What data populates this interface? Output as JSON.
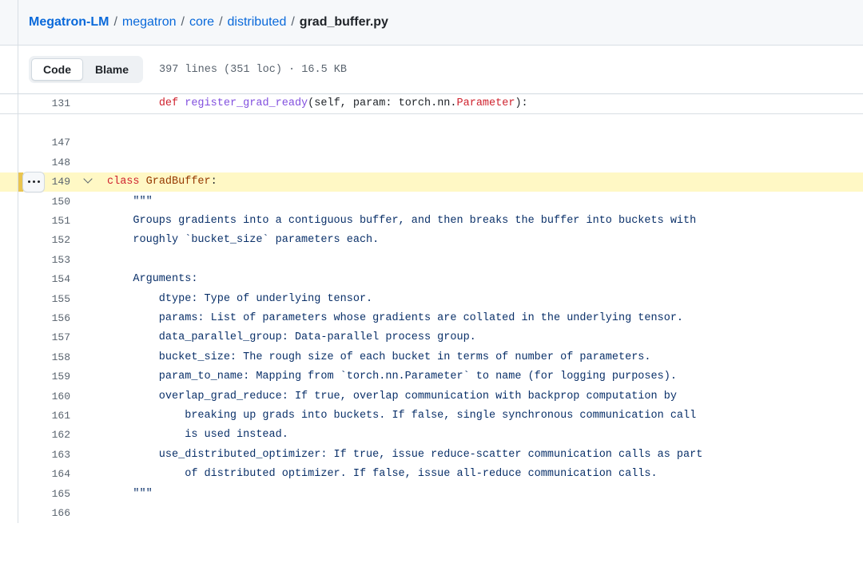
{
  "breadcrumb": {
    "repo": "Megatron-LM",
    "separator": "/",
    "path_parts": [
      "megatron",
      "core",
      "distributed"
    ],
    "filename": "grad_buffer.py"
  },
  "toolbar": {
    "code_tab": "Code",
    "blame_tab": "Blame",
    "file_meta": "397 lines (351 loc) · 16.5 KB",
    "kebab_label": "···"
  },
  "colors": {
    "highlight_bg": "#fff8c5",
    "highlight_marker": "#eac54f",
    "link": "#0969da",
    "keyword": "#cf222e",
    "function": "#8250df",
    "class_name": "#953800",
    "string": "#0a3069",
    "text": "#1f2328",
    "line_number": "#59636e",
    "header_bg": "#f6f8fa",
    "border": "#d8dee4"
  },
  "code": {
    "lines": [
      {
        "num": "131",
        "highlighted": false,
        "fold": "",
        "kebab": false,
        "tokens": [
          {
            "t": "        ",
            "c": "tok-pln"
          },
          {
            "t": "def",
            "c": "tok-kw"
          },
          {
            "t": " ",
            "c": "tok-pln"
          },
          {
            "t": "register_grad_ready",
            "c": "tok-fn"
          },
          {
            "t": "(self, param: torch.nn.",
            "c": "tok-pln"
          },
          {
            "t": "Parameter",
            "c": "tok-type"
          },
          {
            "t": "):",
            "c": "tok-pln"
          }
        ]
      },
      {
        "num": "147",
        "highlighted": false,
        "fold": "",
        "kebab": false,
        "gap_before": true,
        "tokens": []
      },
      {
        "num": "148",
        "highlighted": false,
        "fold": "",
        "kebab": false,
        "tokens": []
      },
      {
        "num": "149",
        "highlighted": true,
        "fold": "chevron-down",
        "kebab": true,
        "tokens": [
          {
            "t": "class",
            "c": "tok-kw"
          },
          {
            "t": " ",
            "c": "tok-pln"
          },
          {
            "t": "GradBuffer",
            "c": "tok-cls"
          },
          {
            "t": ":",
            "c": "tok-pln"
          }
        ]
      },
      {
        "num": "150",
        "highlighted": false,
        "fold": "",
        "kebab": false,
        "tokens": [
          {
            "t": "    \"\"\"",
            "c": "tok-str"
          }
        ]
      },
      {
        "num": "151",
        "highlighted": false,
        "fold": "",
        "kebab": false,
        "tokens": [
          {
            "t": "    Groups gradients into a contiguous buffer, and then breaks the buffer into buckets with",
            "c": "tok-str"
          }
        ]
      },
      {
        "num": "152",
        "highlighted": false,
        "fold": "",
        "kebab": false,
        "tokens": [
          {
            "t": "    roughly `bucket_size` parameters each.",
            "c": "tok-str"
          }
        ]
      },
      {
        "num": "153",
        "highlighted": false,
        "fold": "",
        "kebab": false,
        "tokens": []
      },
      {
        "num": "154",
        "highlighted": false,
        "fold": "",
        "kebab": false,
        "tokens": [
          {
            "t": "    Arguments:",
            "c": "tok-str"
          }
        ]
      },
      {
        "num": "155",
        "highlighted": false,
        "fold": "",
        "kebab": false,
        "tokens": [
          {
            "t": "        dtype: Type of underlying tensor.",
            "c": "tok-str"
          }
        ]
      },
      {
        "num": "156",
        "highlighted": false,
        "fold": "",
        "kebab": false,
        "tokens": [
          {
            "t": "        params: List of parameters whose gradients are collated in the underlying tensor.",
            "c": "tok-str"
          }
        ]
      },
      {
        "num": "157",
        "highlighted": false,
        "fold": "",
        "kebab": false,
        "tokens": [
          {
            "t": "        data_parallel_group: Data-parallel process group.",
            "c": "tok-str"
          }
        ]
      },
      {
        "num": "158",
        "highlighted": false,
        "fold": "",
        "kebab": false,
        "tokens": [
          {
            "t": "        bucket_size: The rough size of each bucket in terms of number of parameters.",
            "c": "tok-str"
          }
        ]
      },
      {
        "num": "159",
        "highlighted": false,
        "fold": "",
        "kebab": false,
        "tokens": [
          {
            "t": "        param_to_name: Mapping from `torch.nn.Parameter` to name (for logging purposes).",
            "c": "tok-str"
          }
        ]
      },
      {
        "num": "160",
        "highlighted": false,
        "fold": "",
        "kebab": false,
        "tokens": [
          {
            "t": "        overlap_grad_reduce: If true, overlap communication with backprop computation by",
            "c": "tok-str"
          }
        ]
      },
      {
        "num": "161",
        "highlighted": false,
        "fold": "",
        "kebab": false,
        "tokens": [
          {
            "t": "            breaking up grads into buckets. If false, single synchronous communication call",
            "c": "tok-str"
          }
        ]
      },
      {
        "num": "162",
        "highlighted": false,
        "fold": "",
        "kebab": false,
        "tokens": [
          {
            "t": "            is used instead.",
            "c": "tok-str"
          }
        ]
      },
      {
        "num": "163",
        "highlighted": false,
        "fold": "",
        "kebab": false,
        "tokens": [
          {
            "t": "        use_distributed_optimizer: If true, issue reduce-scatter communication calls as part",
            "c": "tok-str"
          }
        ]
      },
      {
        "num": "164",
        "highlighted": false,
        "fold": "",
        "kebab": false,
        "tokens": [
          {
            "t": "            of distributed optimizer. If false, issue all-reduce communication calls.",
            "c": "tok-str"
          }
        ]
      },
      {
        "num": "165",
        "highlighted": false,
        "fold": "",
        "kebab": false,
        "tokens": [
          {
            "t": "    \"\"\"",
            "c": "tok-str"
          }
        ]
      },
      {
        "num": "166",
        "highlighted": false,
        "fold": "",
        "kebab": false,
        "tokens": []
      }
    ]
  }
}
